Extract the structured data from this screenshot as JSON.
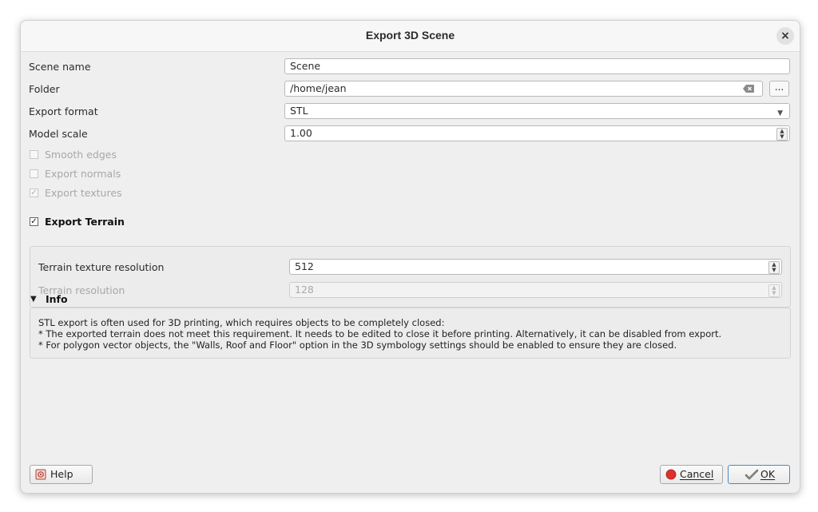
{
  "dialog": {
    "title": "Export 3D Scene",
    "close_label": "×"
  },
  "form": {
    "scene_name": {
      "label": "Scene name",
      "value": "Scene"
    },
    "folder": {
      "label": "Folder",
      "value": "/home/jean",
      "browse_label": "..."
    },
    "export_format": {
      "label": "Export format",
      "value": "STL"
    },
    "model_scale": {
      "label": "Model scale",
      "value": "1.00"
    },
    "smooth_edges": {
      "label": "Smooth edges",
      "checked": false,
      "enabled": false
    },
    "export_normals": {
      "label": "Export normals",
      "checked": false,
      "enabled": false
    },
    "export_textures": {
      "label": "Export textures",
      "checked": true,
      "enabled": false
    }
  },
  "terrain": {
    "title": "Export Terrain",
    "checked": true,
    "texture_resolution": {
      "label": "Terrain texture resolution",
      "value": "512"
    },
    "resolution": {
      "label": "Terrain resolution",
      "value": "128",
      "enabled": false
    }
  },
  "info": {
    "title": "Info",
    "expanded": true,
    "lines": [
      "STL export is often used for 3D printing, which requires objects to be completely closed:",
      "* The exported terrain does not meet this requirement. It needs to be edited to close it before printing. Alternatively, it can be disabled from export.",
      "* For polygon vector objects, the \"Walls, Roof and Floor\" option in the 3D symbology settings should be enabled to ensure they are closed."
    ]
  },
  "buttons": {
    "help": "Help",
    "cancel": "Cancel",
    "ok": "OK"
  },
  "colors": {
    "accent": "#4a86c8",
    "cancel_icon": "#e0302b",
    "dialog_bg": "#efefef"
  },
  "icons": {
    "help": "help-book-icon",
    "cancel": "cancel-red-circle-icon",
    "ok": "ok-check-icon",
    "clear": "clear-text-icon"
  }
}
